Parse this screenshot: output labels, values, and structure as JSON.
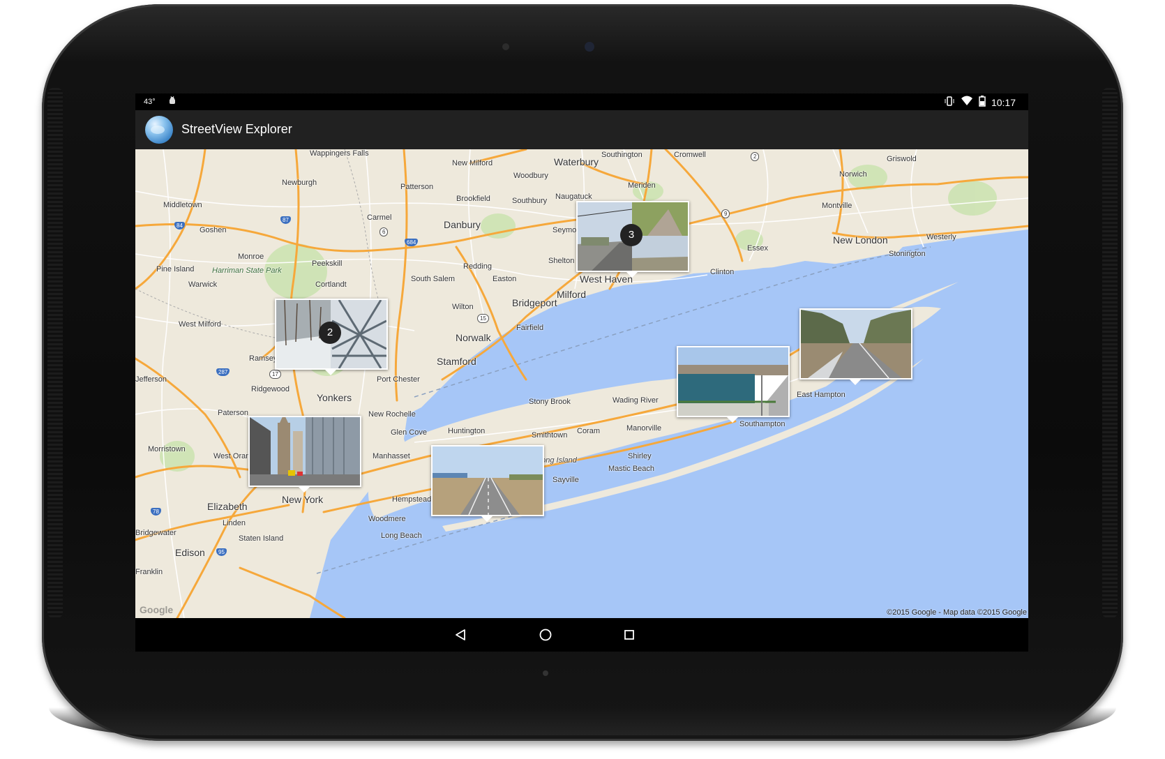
{
  "status_bar": {
    "temperature": "43°",
    "time": "10:17",
    "icons": [
      "android-debug-icon",
      "vibrate-icon",
      "wifi-icon",
      "battery-icon"
    ]
  },
  "action_bar": {
    "title": "StreetView Explorer",
    "icon": "globe-icon"
  },
  "map": {
    "places": [
      {
        "name": "Wappingers Falls"
      },
      {
        "name": "Newburgh"
      },
      {
        "name": "Middletown"
      },
      {
        "name": "Goshen"
      },
      {
        "name": "Monroe"
      },
      {
        "name": "Pine Island"
      },
      {
        "name": "Harriman State Park"
      },
      {
        "name": "Warwick"
      },
      {
        "name": "Peekskill"
      },
      {
        "name": "Cortlandt"
      },
      {
        "name": "West Milford"
      },
      {
        "name": "Ramsey"
      },
      {
        "name": "Jefferson"
      },
      {
        "name": "Ridgewood"
      },
      {
        "name": "Paterson"
      },
      {
        "name": "Yonkers"
      },
      {
        "name": "New Rochelle"
      },
      {
        "name": "Port Chester"
      },
      {
        "name": "Stamford"
      },
      {
        "name": "Norwalk"
      },
      {
        "name": "Wilton"
      },
      {
        "name": "Fairfield"
      },
      {
        "name": "Bridgeport"
      },
      {
        "name": "Milford"
      },
      {
        "name": "Redding"
      },
      {
        "name": "Easton"
      },
      {
        "name": "South Salem"
      },
      {
        "name": "Danbury"
      },
      {
        "name": "Carmel"
      },
      {
        "name": "Patterson"
      },
      {
        "name": "Brookfield"
      },
      {
        "name": "New Milford"
      },
      {
        "name": "Woodbury"
      },
      {
        "name": "Southbury"
      },
      {
        "name": "Waterbury"
      },
      {
        "name": "Naugatuck"
      },
      {
        "name": "Southington"
      },
      {
        "name": "Meriden"
      },
      {
        "name": "Cromwell"
      },
      {
        "name": "Seymour"
      },
      {
        "name": "Shelton"
      },
      {
        "name": "West Haven"
      },
      {
        "name": "Clinton"
      },
      {
        "name": "Essex"
      },
      {
        "name": "New London"
      },
      {
        "name": "Montville"
      },
      {
        "name": "Norwich"
      },
      {
        "name": "Griswold"
      },
      {
        "name": "Westerly"
      },
      {
        "name": "Stonington"
      },
      {
        "name": "Morristown"
      },
      {
        "name": "West Orange"
      },
      {
        "name": "Elizabeth"
      },
      {
        "name": "Linden"
      },
      {
        "name": "Staten Island"
      },
      {
        "name": "Edison"
      },
      {
        "name": "New York"
      },
      {
        "name": "Manhasset"
      },
      {
        "name": "Glen Cove"
      },
      {
        "name": "Huntington"
      },
      {
        "name": "Hempstead"
      },
      {
        "name": "Woodmere"
      },
      {
        "name": "Long Beach"
      },
      {
        "name": "Stony Brook"
      },
      {
        "name": "Smithtown"
      },
      {
        "name": "Coram"
      },
      {
        "name": "Long Island"
      },
      {
        "name": "Sayville"
      },
      {
        "name": "Shirley"
      },
      {
        "name": "Mastic Beach"
      },
      {
        "name": "Manorville"
      },
      {
        "name": "Wading River"
      },
      {
        "name": "Southampton"
      },
      {
        "name": "East Hampton"
      },
      {
        "name": "Bridgewater"
      },
      {
        "name": "Franklin"
      }
    ],
    "shields": [
      "87",
      "84",
      "684",
      "6",
      "9",
      "2",
      "15",
      "287",
      "17",
      "78",
      "95"
    ],
    "copyright": "©2015 Google - Map data ©2015 Google",
    "logo": "Google"
  },
  "markers": [
    {
      "label": "street-view-cluster-2",
      "count": "2"
    },
    {
      "label": "street-view-cluster-3",
      "count": "3"
    },
    {
      "label": "street-view-manhattan",
      "count": ""
    },
    {
      "label": "street-view-long-island-road",
      "count": ""
    },
    {
      "label": "street-view-bridge-water",
      "count": ""
    },
    {
      "label": "street-view-east-hampton-road",
      "count": ""
    }
  ],
  "colors": {
    "water": "#a6c6f7",
    "land": "#eee9dc",
    "highway": "#f6a83b",
    "road": "#ffffff",
    "park": "#c5e3a8",
    "action_bar": "#212121",
    "status_bar": "#000000"
  },
  "nav_bar": {
    "buttons": [
      "back-icon",
      "home-icon",
      "recents-icon"
    ]
  }
}
